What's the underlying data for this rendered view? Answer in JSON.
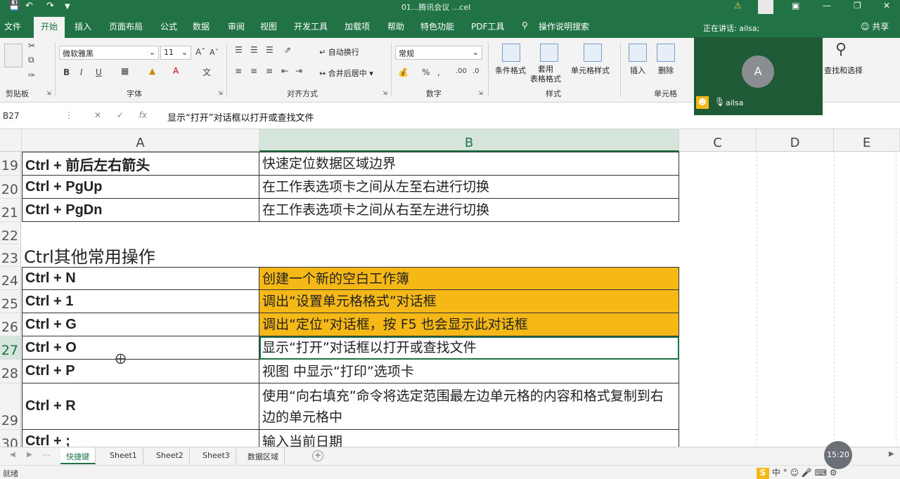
{
  "window": {
    "title": "01...腾讯会议 ...cel",
    "save_icon": "save-icon",
    "undo_icon": "undo-icon",
    "redo_icon": "redo-icon"
  },
  "menu": {
    "tabs": [
      "文件",
      "开始",
      "插入",
      "页面布局",
      "公式",
      "数据",
      "审阅",
      "视图",
      "开发工具",
      "加载项",
      "帮助",
      "特色功能",
      "PDF工具",
      "操作说明搜索"
    ],
    "active_tab": "开始",
    "speaking": "正在讲话: ailsa;",
    "share": "共享"
  },
  "ribbon": {
    "font_name": "微软雅黑",
    "font_size": "11",
    "number_format": "常规",
    "wrap_text": "自动换行",
    "merge_center": "合并后居中",
    "conditional_format": "条件格式",
    "table_format": "套用\n表格格式",
    "cell_style": "单元格样式",
    "insert": "插入",
    "delete": "删除",
    "find_select": "查找和选择",
    "groups": {
      "clipboard": "剪贴板",
      "font": "字体",
      "alignment": "对齐方式",
      "number": "数字",
      "styles": "样式",
      "cells": "单元格"
    }
  },
  "formula_bar": {
    "name_box": "B27",
    "formula": "显示“打开”对话框以打开或查找文件"
  },
  "columns": [
    "A",
    "B",
    "C",
    "D",
    "E"
  ],
  "rows": [
    {
      "num": "19",
      "a": "Ctrl + 前后左右箭头",
      "b": " 快速定位数据区域边界"
    },
    {
      "num": "20",
      "a": "Ctrl + PgUp",
      "b": " 在工作表选项卡之间从左至右进行切换"
    },
    {
      "num": "21",
      "a": "Ctrl + PgDn",
      "b": "在工作表选项卡之间从右至左进行切换"
    },
    {
      "num": "22"
    },
    {
      "num": "23",
      "heading": "Ctrl其他常用操作"
    },
    {
      "num": "24",
      "a": "Ctrl + N",
      "b": "创建一个新的空白工作簿"
    },
    {
      "num": "25",
      "a": "Ctrl + 1",
      "b": "调出“设置单元格格式”对话框"
    },
    {
      "num": "26",
      "a": "Ctrl + G",
      "b": "调出“定位”对话框，按 F5 也会显示此对话框"
    },
    {
      "num": "27",
      "a": "Ctrl + O",
      "b": "显示“打开”对话框以打开或查找文件"
    },
    {
      "num": "28",
      "a": "Ctrl + P",
      "b": "视图 中显示“打印”选项卡"
    },
    {
      "num": "29",
      "a": "Ctrl + R",
      "b": "使用“向右填充”命令将选定范围最左边单元格的内容和格式复制到右边的单元格中"
    },
    {
      "num": "30",
      "a": "Ctrl + ;",
      "b": "输入当前日期"
    }
  ],
  "highlight_color": "#f6b817",
  "sheets": [
    "快捷键",
    "Sheet1",
    "Sheet2",
    "Sheet3",
    "数据区域"
  ],
  "active_sheet": "快捷键",
  "status": {
    "ready": "就绪",
    "ime": "中"
  },
  "meeting": {
    "avatar_letter": "A",
    "name": "ailsa"
  },
  "clock": "15:20"
}
